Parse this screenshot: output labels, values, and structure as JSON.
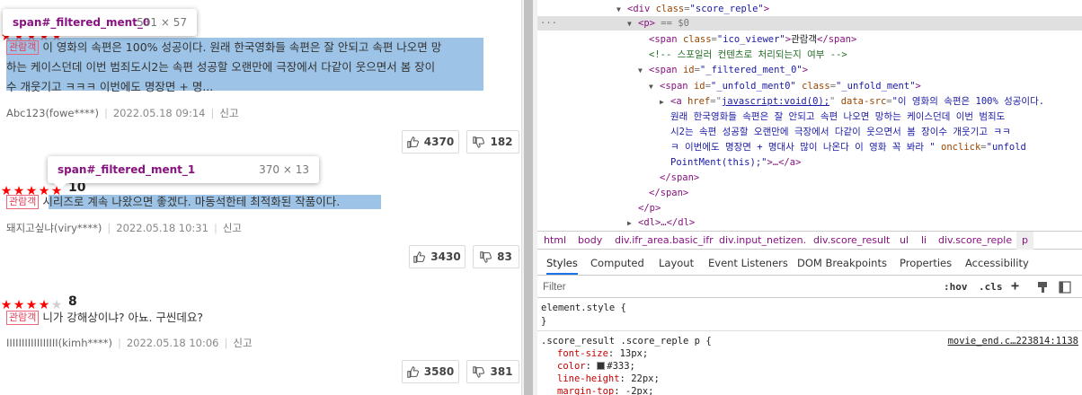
{
  "reviews": [
    {
      "rating": 10,
      "score": "10",
      "badge": "관람객",
      "lines": [
        "이 영화의 속편은 100% 성공이다. 원래 한국영화들 속편은 잘 안되고 속편 나오면 망",
        "하는 케이스던데 이번 범죄도시2는 속편 성공할 오랜만에 극장에서 다같이 웃으면서 봄 장이",
        "수 개웃기고 ㅋㅋㅋ 이번에도 명장면 + 명..."
      ],
      "user": "Abc123(fowe****)",
      "date": "2022.05.18 09:14",
      "report": "신고",
      "likes": "4370",
      "dislikes": "182",
      "tooltip": {
        "tag": "span#_filtered_ment_0",
        "dims": "531 × 57"
      }
    },
    {
      "rating": 10,
      "score": "10",
      "badge": "관람객",
      "lines": [
        "시리즈로 계속 나왔으면 좋겠다. 마동석한테 최적화된 작품이다."
      ],
      "user": "돼지고싶냐(viry****)",
      "date": "2022.05.18 10:31",
      "report": "신고",
      "likes": "3430",
      "dislikes": "83",
      "tooltip": {
        "tag": "span#_filtered_ment_1",
        "dims": "370 × 13"
      }
    },
    {
      "rating": 8,
      "score": "8",
      "badge": "관람객",
      "lines": [
        "니가 강해상이냐? 아뇨. 구씬데요?"
      ],
      "user": "IIIIIIIIIIIIIIIII(kimh****)",
      "date": "2022.05.18 10:06",
      "report": "신고",
      "likes": "3580",
      "dislikes": "381"
    }
  ],
  "devtools": {
    "dom": {
      "l1_tag_open": "<div ",
      "l1_attr": "class",
      "l1_val": "\"score_reple\"",
      "l1_close": ">",
      "l2_tag": "<p>",
      "l2_eq": " == $0",
      "l3_open": "<span ",
      "l3_attr": "class",
      "l3_val": "\"ico_viewer\"",
      "l3_text": "관람객",
      "l3_close": "</span>",
      "l4_comment": "<!-- 스포일러 컨텐츠로 처리되는지 여부 -->",
      "l5_open": "<span ",
      "l5_attr": "id",
      "l5_val": "\"_filtered_ment_0\"",
      "l6_open": "<span ",
      "l6_attr1": "id",
      "l6_val1": "\"_unfold_ment0\"",
      "l6_attr2": "class",
      "l6_val2": "\"_unfold_ment\"",
      "l7_open": "<a ",
      "l7_attr1": "href",
      "l7_val1": "javascript:void(0);",
      "l7_attr2": "data-src",
      "l7_val2a": "\"이 영화의 속편은 100% 성공이다.",
      "l8": "원래 한국영화들 속편은 잘 안되고 속편 나오면 망하는 케이스던데 이번 범죄도",
      "l9": "시2는 속편 성공할 오랜만에 극장에서 다같이 웃으면서 봄 장이수 개웃기고 ㅋㅋ",
      "l10a": "ㅋ 이번에도 명장면 + 명대사 많이 나온다 이 영화 꼭 봐라 \"",
      "l10_attr": "onclick",
      "l10_val": "\"unfold",
      "l11_val": "PointMent(this);\"",
      "l11_rest": ">…</a>",
      "l12": "</span>",
      "l13": "</span>",
      "l14": "</p>",
      "l15": "<dl>…</dl>"
    },
    "breadcrumb": [
      "html",
      "body",
      "div.ifr_area.basic_ifr",
      "div.input_netizen.",
      "div.score_result",
      "ul",
      "li",
      "div.score_reple",
      "p"
    ],
    "tabs": [
      "Styles",
      "Computed",
      "Layout",
      "Event Listeners",
      "DOM Breakpoints",
      "Properties",
      "Accessibility"
    ],
    "filter_placeholder": "Filter",
    "hov": ":hov",
    "cls": ".cls",
    "plus": "+",
    "element_style": "element.style {",
    "close_brace": "}",
    "rule_selector": ".score_result .score_reple p {",
    "rule_source": "movie_end.c…223814:1138",
    "props": [
      {
        "name": "font-size",
        "value": "13px;"
      },
      {
        "name": "color",
        "value": "#333;"
      },
      {
        "name": "line-height",
        "value": "22px;"
      },
      {
        "name": "margin-top",
        "value": "-2px;"
      }
    ]
  }
}
